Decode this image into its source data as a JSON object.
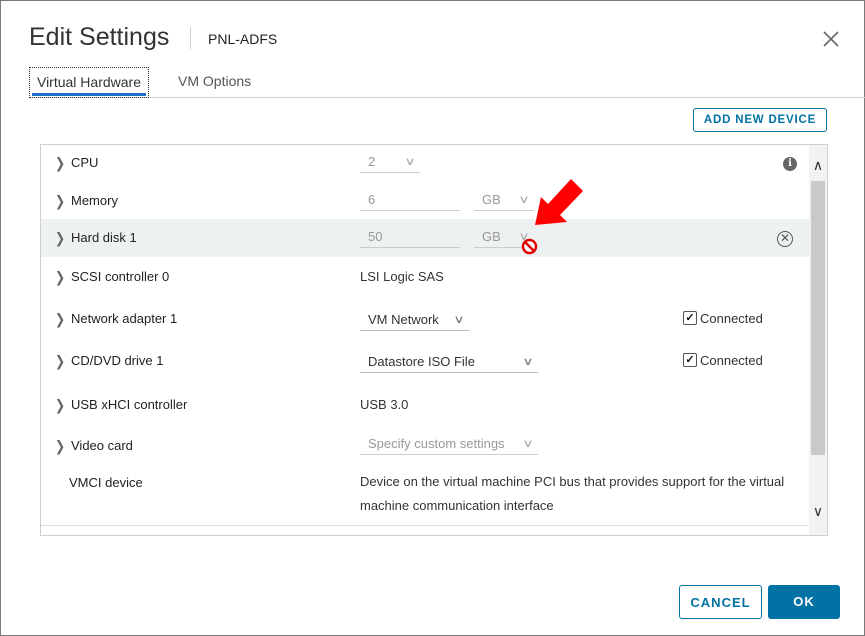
{
  "dialog": {
    "title": "Edit Settings",
    "vm_name": "PNL-ADFS",
    "close_icon": "close-icon"
  },
  "tabs": [
    {
      "label": "Virtual Hardware",
      "active": true
    },
    {
      "label": "VM Options",
      "active": false
    }
  ],
  "add_device_label": "ADD NEW DEVICE",
  "devices": {
    "cpu": {
      "label": "CPU",
      "value": "2"
    },
    "memory": {
      "label": "Memory",
      "value": "6",
      "unit": "GB"
    },
    "hard_disk": {
      "label": "Hard disk 1",
      "value": "50",
      "unit": "GB"
    },
    "scsi": {
      "label": "SCSI controller 0",
      "value": "LSI Logic SAS"
    },
    "network": {
      "label": "Network adapter 1",
      "value": "VM Network",
      "connected_label": "Connected",
      "connected": true
    },
    "cddvd": {
      "label": "CD/DVD drive 1",
      "value": "Datastore ISO File",
      "connected_label": "Connected",
      "connected": true
    },
    "usb": {
      "label": "USB xHCI controller",
      "value": "USB 3.0"
    },
    "video": {
      "label": "Video card",
      "value": "Specify custom settings"
    },
    "vmci": {
      "label": "VMCI device",
      "description": "Device on the virtual machine PCI bus that provides support for the virtual machine communication interface"
    }
  },
  "footer": {
    "cancel_label": "CANCEL",
    "ok_label": "OK"
  },
  "colors": {
    "accent": "#0072a3",
    "tab_underline": "#1d70c9",
    "annotation_arrow": "#ff0000",
    "highlight_row": "#edf1ef"
  }
}
